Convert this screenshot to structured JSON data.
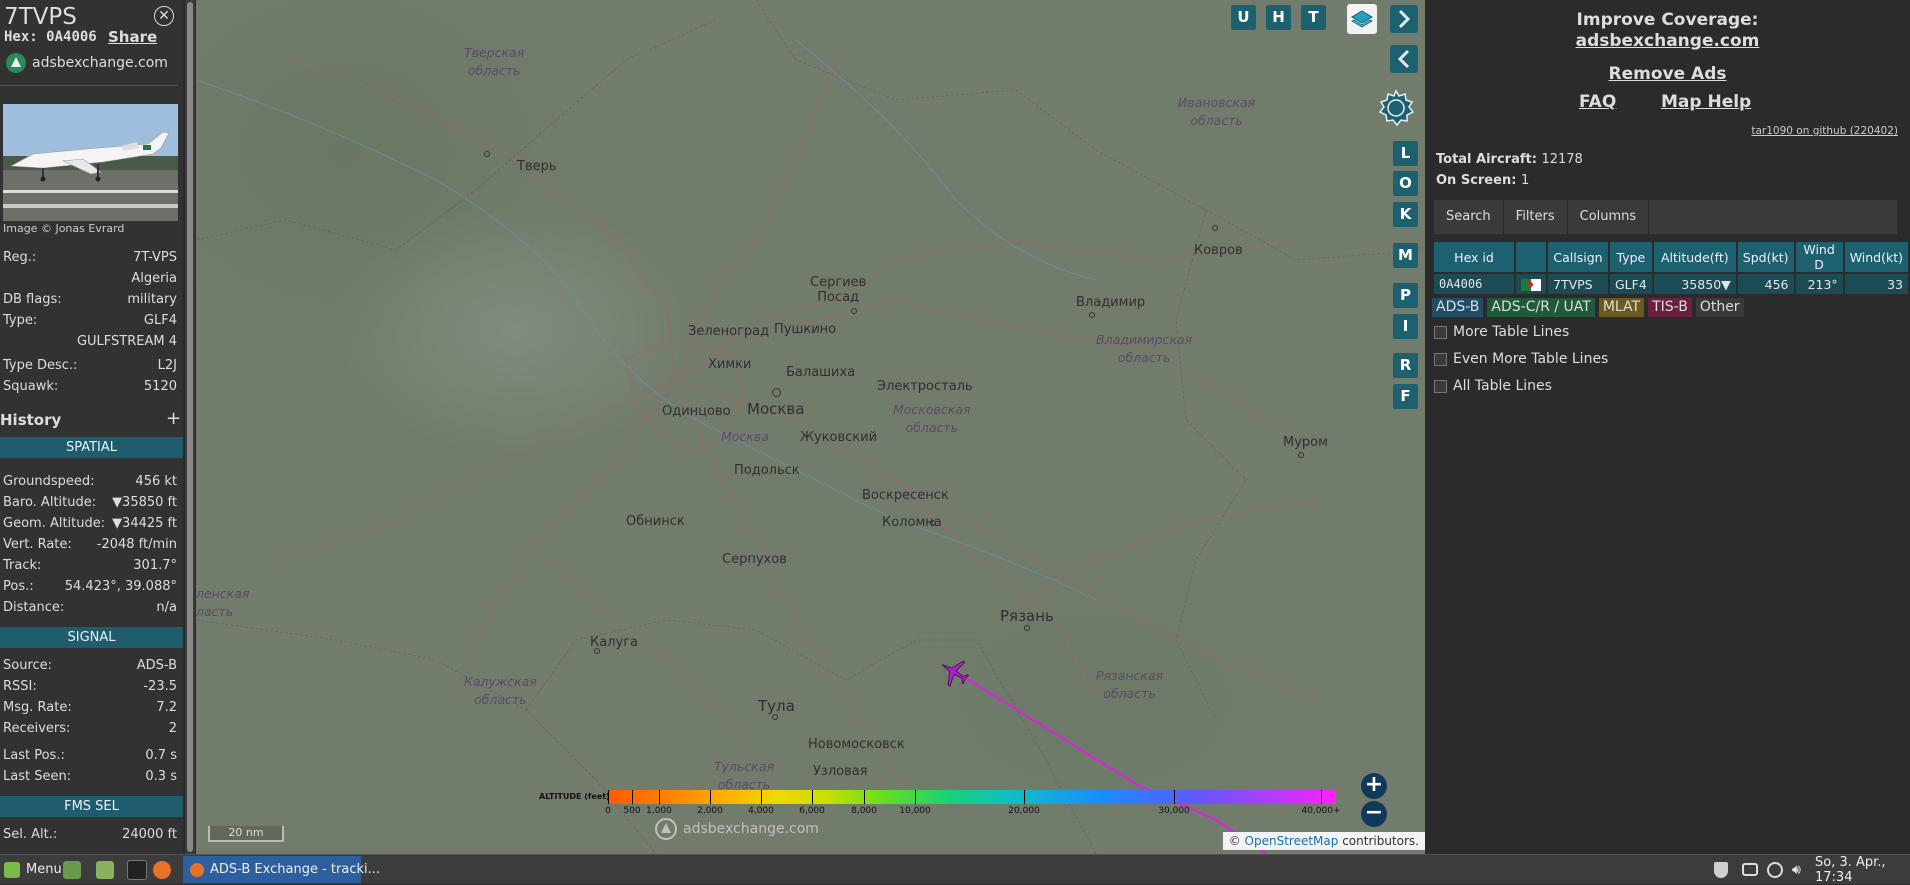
{
  "aircraft": {
    "callsign": "7TVPS",
    "hex_label": "Hex:",
    "hex": "0A4006",
    "share_label": "Share",
    "site": "adsbexchange.com",
    "photo_credit": "Image © Jonas Evrard",
    "registration_label": "Reg.:",
    "registration": "7T-VPS",
    "country": "Algeria",
    "db_flags_label": "DB flags:",
    "db_flags": "military",
    "type_label": "Type:",
    "type": "GLF4",
    "type_full": "GULFSTREAM 4",
    "type_desc_label": "Type Desc.:",
    "type_desc": "L2J",
    "squawk_label": "Squawk:",
    "squawk": "5120"
  },
  "history": {
    "title": "History",
    "add": "+"
  },
  "spatial": {
    "title": "SPATIAL",
    "rows": [
      {
        "label": "Groundspeed:",
        "value": "456 kt"
      },
      {
        "label": "Baro. Altitude:",
        "value": "▼35850 ft"
      },
      {
        "label": "Geom. Altitude:",
        "value": "▼34425 ft"
      },
      {
        "label": "Vert. Rate:",
        "value": "-2048 ft/min"
      },
      {
        "label": "Track:",
        "value": "301.7°"
      },
      {
        "label": "Pos.:",
        "value": "54.423°, 39.088°"
      },
      {
        "label": "Distance:",
        "value": "n/a"
      }
    ]
  },
  "signal": {
    "title": "SIGNAL",
    "rows": [
      {
        "label": "Source:",
        "value": "ADS-B"
      },
      {
        "label": "RSSI:",
        "value": "-23.5"
      },
      {
        "label": "Msg. Rate:",
        "value": "7.2"
      },
      {
        "label": "Receivers:",
        "value": "2"
      },
      {
        "label": "Last Pos.:",
        "value": "0.7 s"
      },
      {
        "label": "Last Seen:",
        "value": "0.3 s"
      }
    ]
  },
  "fms": {
    "title": "FMS SEL",
    "sel_alt_label": "Sel. Alt.:",
    "sel_alt": "24000 ft"
  },
  "map": {
    "top_buttons": [
      "U",
      "H",
      "T"
    ],
    "side_buttons": [
      "L",
      "O",
      "K",
      "M",
      "P",
      "I",
      "R",
      "F"
    ],
    "scale": "20 nm",
    "zoom_in": "+",
    "zoom_out": "−",
    "attribution_prefix": "©",
    "attribution_link": "OpenStreetMap",
    "attribution_suffix": "contributors.",
    "watermark": "adsbexchange.com",
    "altitude_title": "ALTITUDE (feet)",
    "altitude_ticks": [
      "0",
      "500",
      "1,000",
      "2,000",
      "4,000",
      "6,000",
      "8,000",
      "10,000",
      "20,000",
      "30,000",
      "40,000+"
    ],
    "cities": {
      "tver": "Тверь",
      "sergiev": "Сергиев\nПосад",
      "kovrov": "Ковров",
      "vladimir": "Владимир",
      "zelenograd": "Зеленоград",
      "pushkino": "Пушкино",
      "khimki": "Химки",
      "balashikha": "Балашиха",
      "odintsovo": "Одинцово",
      "moskva": "Москва",
      "elektrostal": "Электросталь",
      "moskva_r": "Москва",
      "zhukovsky": "Жуковский",
      "podolsk": "Подольск",
      "murom": "Муром",
      "voskresensk": "Воскресенск",
      "obninsk": "Обнинск",
      "kolomna": "Коломна",
      "serpukhov": "Серпухов",
      "ryazan": "Рязань",
      "kaluga": "Калуга",
      "tula": "Тула",
      "novomoskovsk": "Новомосковск",
      "uzlovaya": "Узловая"
    },
    "regions": {
      "tverskaya": "Тверская\nобласть",
      "ivanovskaya": "Ивановская\nобласть",
      "vladimirskaya": "Владимирская\nобласть",
      "moskovskaya": "Московская\nобласть",
      "ryazanskaya": "Рязанская\nобласть",
      "kaluzhskaya": "Калужская\nобласть",
      "tulskaya": "Тульская\nобласть",
      "smolenskaya": "ленская\nласть"
    }
  },
  "sidebar": {
    "improve_title": "Improve Coverage:",
    "improve_link": "adsbexchange.com",
    "remove_ads": "Remove Ads",
    "faq": "FAQ",
    "map_help": "Map Help",
    "github": "tar1090 on github (220402)",
    "total_label": "Total Aircraft:",
    "total": "12178",
    "onscreen_label": "On Screen:",
    "onscreen": "1",
    "tabs": [
      "Search",
      "Filters",
      "Columns"
    ],
    "columns": [
      "Hex id",
      "",
      "Callsign",
      "Type",
      "Altitude(ft)",
      "Spd(kt)",
      "Wind D",
      "Wind(kt)"
    ],
    "row": {
      "hex": "0A4006",
      "callsign": "7TVPS",
      "type": "GLF4",
      "altitude": "35850▼",
      "speed": "456",
      "wind_dir": "213°",
      "wind": "33"
    },
    "sources": [
      "ADS-B",
      "ADS-C/R / UAT",
      "MLAT",
      "TIS-B",
      "Other"
    ],
    "source_colors": [
      "#1f4e66",
      "#1f5a3a",
      "#6a5a20",
      "#6a2040",
      "#3a3a3a"
    ],
    "checkboxes": [
      "More Table Lines",
      "Even More Table Lines",
      "All Table Lines"
    ]
  },
  "taskbar": {
    "menu": "Menu",
    "window_title": "ADS-B Exchange - tracki...",
    "clock": "So, 3. Apr., 17:34"
  },
  "colors": {
    "accent": "#1d6170",
    "track": "#e020e0",
    "plane": "#b020d0"
  }
}
